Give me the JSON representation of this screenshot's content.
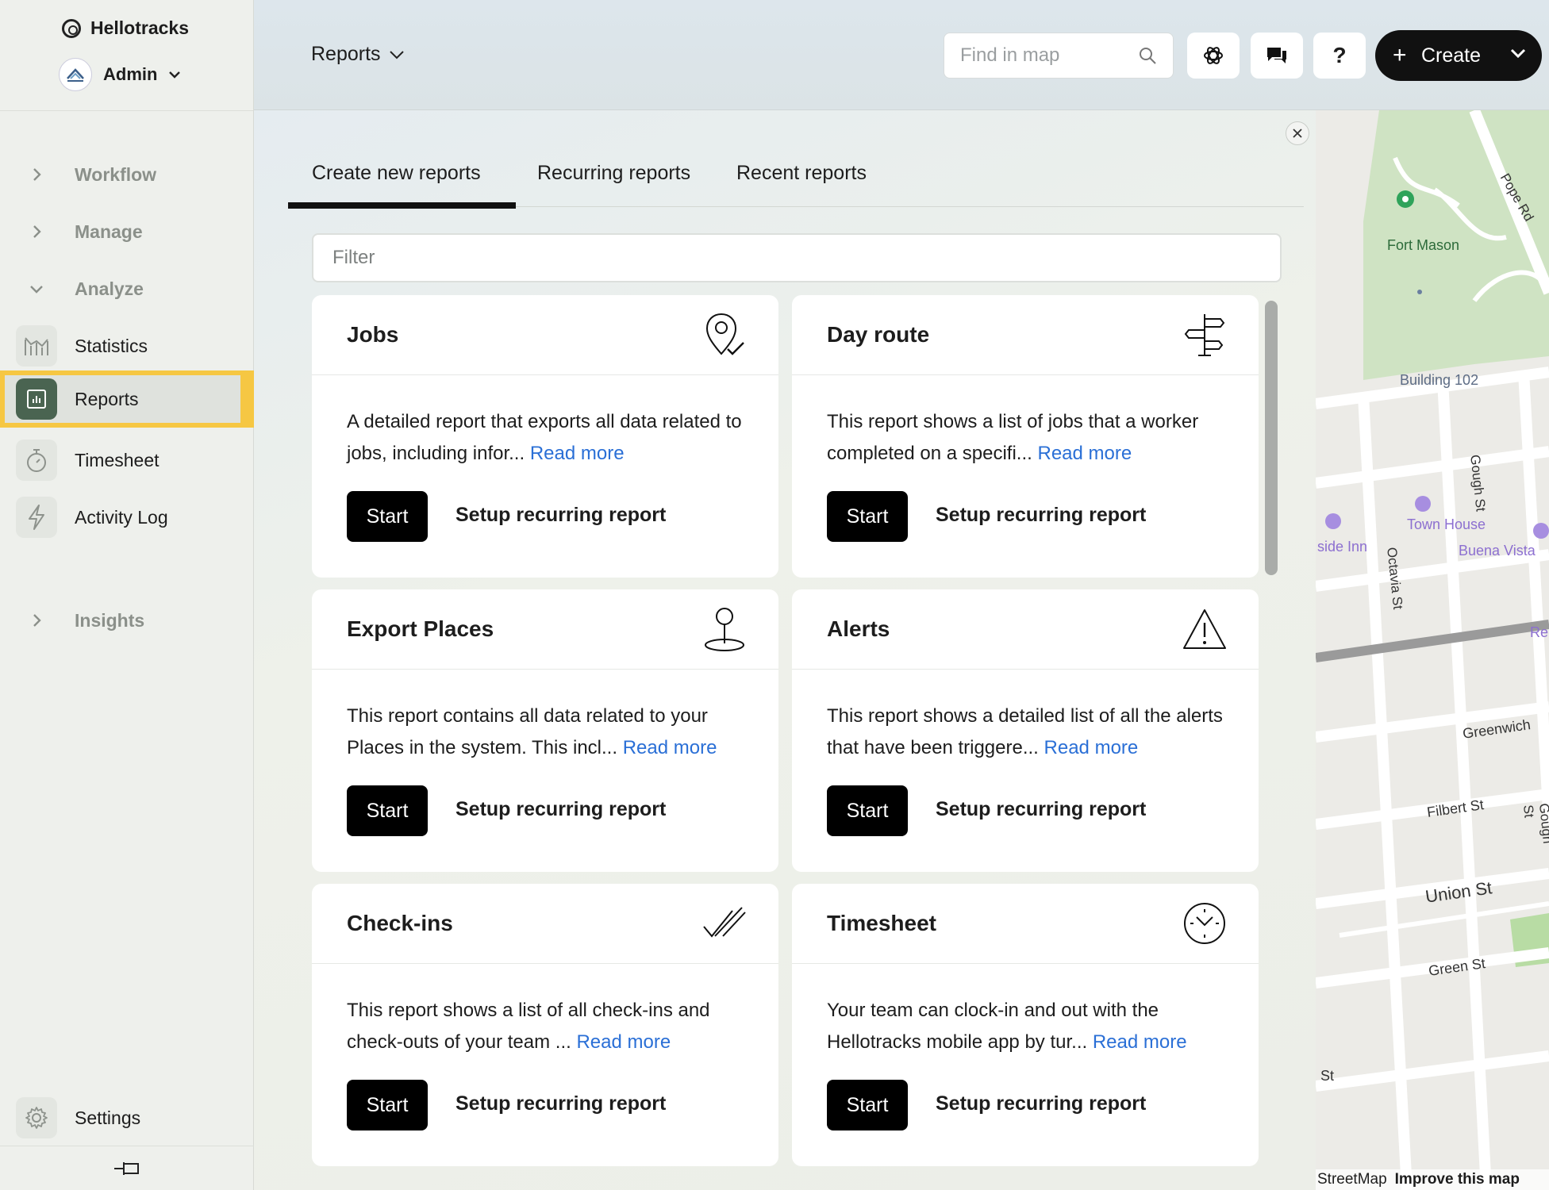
{
  "sidebar": {
    "brand": "Hellotracks",
    "account": "Admin",
    "groups": {
      "workflow": "Workflow",
      "manage": "Manage",
      "analyze": "Analyze",
      "insights": "Insights"
    },
    "items": [
      {
        "label": "Statistics",
        "icon": "bar-chart-icon"
      },
      {
        "label": "Reports",
        "icon": "report-icon",
        "active": true
      },
      {
        "label": "Timesheet",
        "icon": "stopwatch-icon"
      },
      {
        "label": "Activity Log",
        "icon": "lightning-icon"
      }
    ],
    "settings": "Settings"
  },
  "header": {
    "menu_label": "Reports",
    "search_placeholder": "Find in map",
    "help_label": "?",
    "create_label": "Create"
  },
  "panel": {
    "tabs": [
      {
        "label": "Create new reports",
        "active": true
      },
      {
        "label": "Recurring reports"
      },
      {
        "label": "Recent reports"
      }
    ],
    "filter_placeholder": "Filter",
    "start_label": "Start",
    "setup_label": "Setup recurring report",
    "read_more": "Read more",
    "cards": [
      {
        "title": "Jobs",
        "icon": "map-pin-check-icon",
        "desc": "A detailed report that exports all data related to jobs, including infor..."
      },
      {
        "title": "Day route",
        "icon": "signpost-icon",
        "desc": "This report shows a list of jobs that a worker completed on a specifi..."
      },
      {
        "title": "Export Places",
        "icon": "place-pin-icon",
        "desc": "This report contains all data related to your Places in the system. This incl..."
      },
      {
        "title": "Alerts",
        "icon": "warning-triangle-icon",
        "desc": "This report shows a detailed list of all the alerts that have been triggere..."
      },
      {
        "title": "Check-ins",
        "icon": "double-check-icon",
        "desc": "This report shows a list of all check-ins and check-outs of your team ..."
      },
      {
        "title": "Timesheet",
        "icon": "clock-icon",
        "desc": "Your team can clock-in and out with the Hellotracks mobile app by tur..."
      }
    ]
  },
  "map": {
    "labels": [
      "Fort Mason",
      "Pope Rd",
      "Building 102",
      "Gough St",
      "Octavia St",
      "Town House",
      "Buena Vista",
      "side Inn",
      "Greenwich",
      "Filbert St",
      "Gough St",
      "Union St",
      "Green St",
      "St",
      "Re"
    ],
    "footer_left": "StreetMap",
    "footer_right": "Improve this map"
  },
  "colors": {
    "accent": "#f6c743",
    "active_icon": "#4a6451",
    "link": "#2a6fd6",
    "button": "#000000"
  }
}
